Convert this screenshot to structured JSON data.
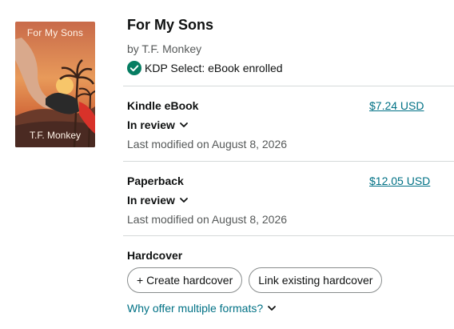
{
  "book": {
    "cover_title": "For My Sons",
    "cover_author": "T.F. Monkey",
    "title": "For My Sons",
    "author_line": "by T.F. Monkey",
    "kdp_select": "KDP Select: eBook enrolled"
  },
  "formats": [
    {
      "name": "Kindle eBook",
      "status": "In review",
      "modified": "Last modified on August 8, 2026",
      "price": "$7.24 USD"
    },
    {
      "name": "Paperback",
      "status": "In review",
      "modified": "Last modified on August 8, 2026",
      "price": "$12.05 USD"
    }
  ],
  "hardcover": {
    "name": "Hardcover",
    "create_label": "+ Create hardcover",
    "link_label": "Link existing hardcover",
    "why_label": "Why offer multiple formats?"
  },
  "colors": {
    "link": "#007185",
    "check_green": "#067d62",
    "divider": "#d5d9d9"
  }
}
